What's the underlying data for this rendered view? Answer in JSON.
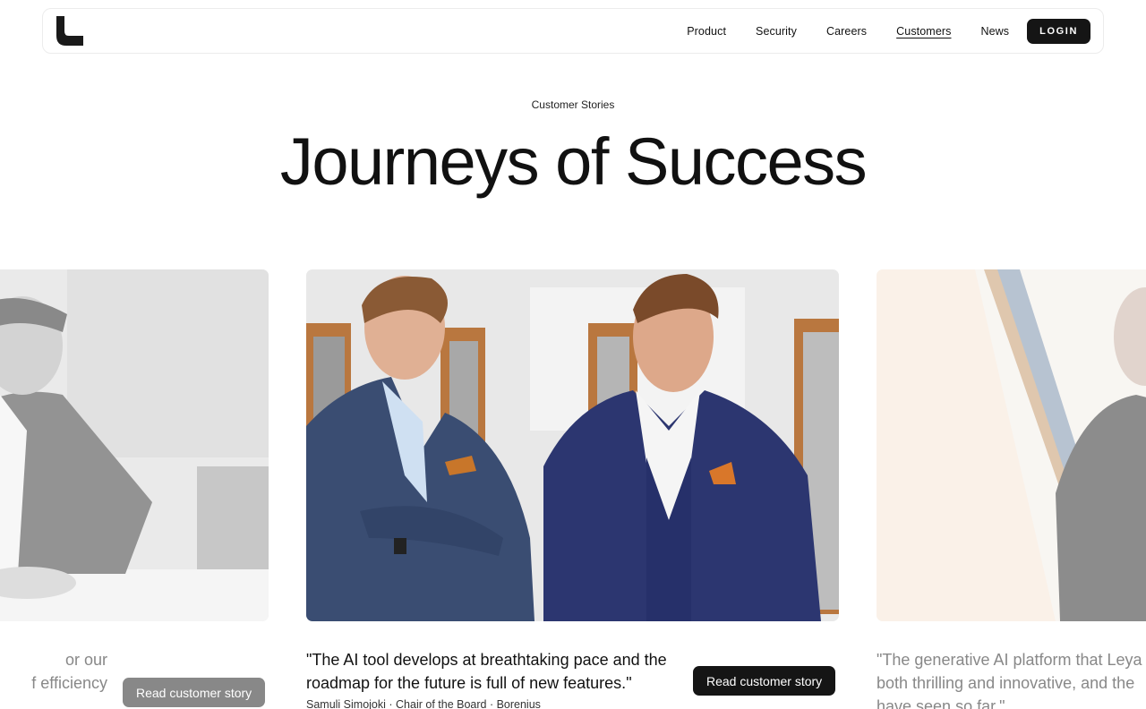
{
  "nav": {
    "logo_name": "brand-logo",
    "links": [
      "Product",
      "Security",
      "Careers",
      "Customers",
      "News"
    ],
    "active": "Customers",
    "login_label": "LOGIN"
  },
  "header": {
    "eyebrow": "Customer Stories",
    "title": "Journeys of Success"
  },
  "cards": {
    "left": {
      "quote_partial": "or our\nf efficiency",
      "button_label": "Read customer story"
    },
    "center": {
      "quote": "\"The AI tool develops at breathtaking pace and the roadmap for the future is full of new features.\"",
      "attribution": "Samuli Simojoki · Chair of the Board · Borenius",
      "button_label": "Read customer story"
    },
    "right": {
      "quote_partial": "\"The generative AI platform that Leya is both thrilling and innovative, and the have seen so far.\""
    }
  },
  "colors": {
    "accent_dark": "#151515",
    "muted_button": "#888888"
  }
}
